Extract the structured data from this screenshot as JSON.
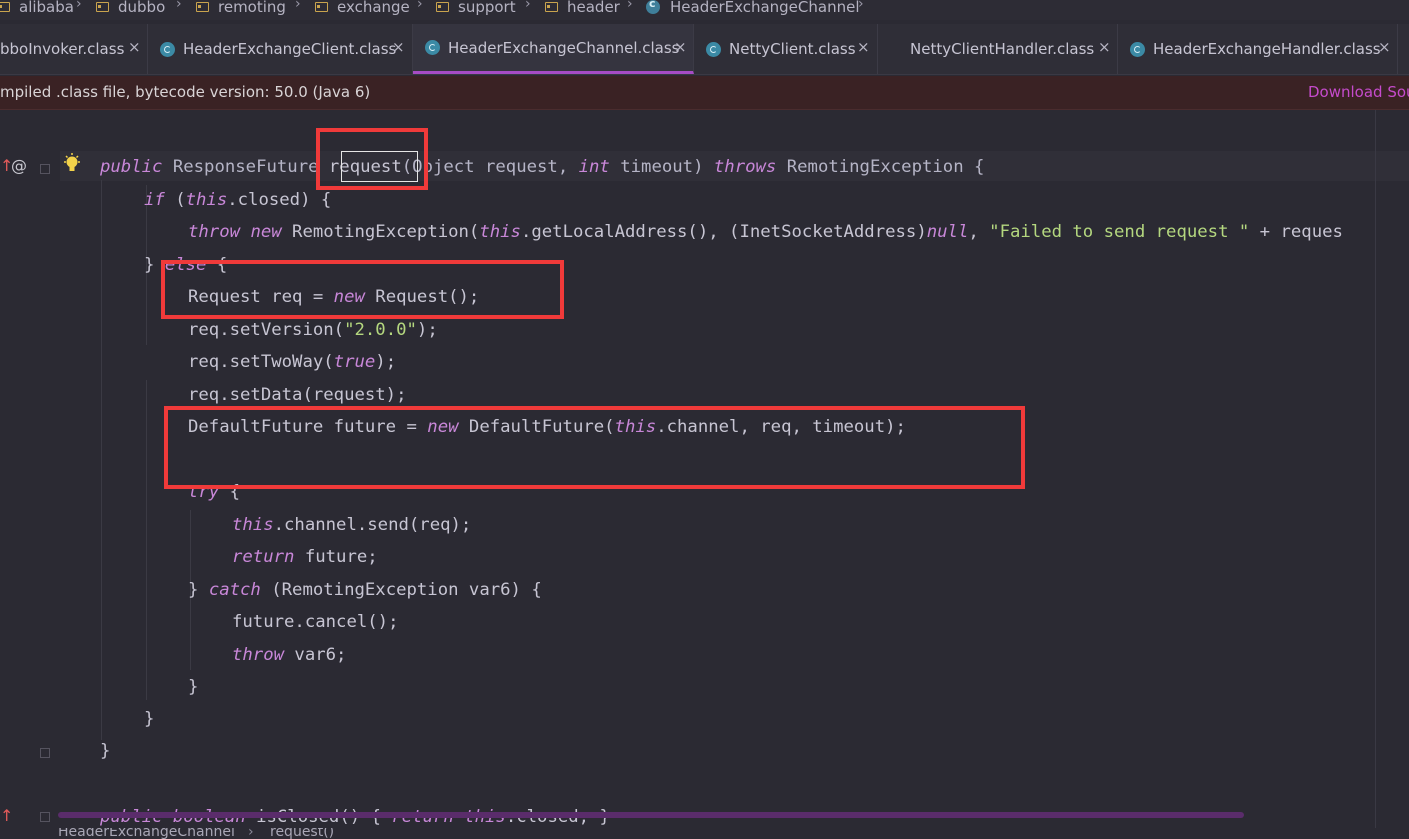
{
  "breadcrumb": {
    "items": [
      "alibaba",
      "dubbo",
      "remoting",
      "exchange",
      "support",
      "header",
      "HeaderExchangeChannel"
    ]
  },
  "tabs": [
    {
      "label": "bboInvoker.class",
      "active": false
    },
    {
      "label": "HeaderExchangeClient.class",
      "active": false
    },
    {
      "label": "HeaderExchangeChannel.class",
      "active": true
    },
    {
      "label": "NettyClient.class",
      "active": false
    },
    {
      "label": "NettyClientHandler.class",
      "active": false
    },
    {
      "label": "HeaderExchangeHandler.class",
      "active": false
    }
  ],
  "banner": {
    "text": "mpiled .class file, bytecode version: 50.0 (Java 6)",
    "link": "Download Sou"
  },
  "gutter": {
    "override_icon": "↑",
    "annotation": "@",
    "bulb_icon": "lightbulb-icon"
  },
  "code": {
    "l0": {
      "kw1": "public",
      "t1": " ResponseFuture ",
      "m": "request",
      "t2": "(Object request, ",
      "kw2": "int",
      "t3": " timeout) ",
      "kw3": "throws",
      "t4": " RemotingException {"
    },
    "l1": {
      "kw1": "if",
      "t1": " (",
      "kw2": "this",
      "t2": ".closed) {"
    },
    "l2": {
      "kw1": "throw",
      "t1": " ",
      "kw2": "new",
      "t2": " RemotingException(",
      "kw3": "this",
      "t3": ".getLocalAddress(), (InetSocketAddress)",
      "kw4": "null",
      "t4": ", ",
      "s": "\"Failed to send request \"",
      "t5": " + reques"
    },
    "l3": {
      "t1": "} ",
      "kw1": "else",
      "t2": " {"
    },
    "l4": {
      "t1": "Request req = ",
      "kw1": "new",
      "t2": " Request();"
    },
    "l5": {
      "t1": "req.setVersion(",
      "s": "\"2.0.0\"",
      "t2": ");"
    },
    "l6": {
      "t1": "req.setTwoWay(",
      "kw1": "true",
      "t2": ");"
    },
    "l7": {
      "t1": "req.setData(request);"
    },
    "l8": {
      "t1": "DefaultFuture future = ",
      "kw1": "new",
      "t2": " DefaultFuture(",
      "kw2": "this",
      "t3": ".channel, req, timeout);"
    },
    "l9": {
      "kw1": "try",
      "t1": " {"
    },
    "l10": {
      "kw1": "this",
      "t1": ".channel.send(req);"
    },
    "l11": {
      "kw1": "return",
      "t1": " future;"
    },
    "l12": {
      "t1": "} ",
      "kw1": "catch",
      "t2": " (RemotingException var6) {"
    },
    "l13": {
      "t1": "future.cancel();"
    },
    "l14": {
      "kw1": "throw",
      "t1": " var6;"
    },
    "l15": {
      "t1": "}"
    },
    "l16": {
      "t1": "}"
    },
    "l17": {
      "t1": "}"
    },
    "l18": {
      "kw1": "public",
      "t1": " ",
      "kw2": "boolean",
      "t2": " isClosed() { ",
      "kw3": "return",
      "t3": " ",
      "kw4": "this",
      "t4": ".closed; }"
    }
  },
  "status": {
    "crumb1": "HeaderExchangeChannel",
    "crumb2": "request()"
  },
  "colors": {
    "annotation_box": "#f03a3a",
    "active_tab_underline": "#a64cc5",
    "keyword": "#c887d8",
    "string": "#b4d77f"
  }
}
